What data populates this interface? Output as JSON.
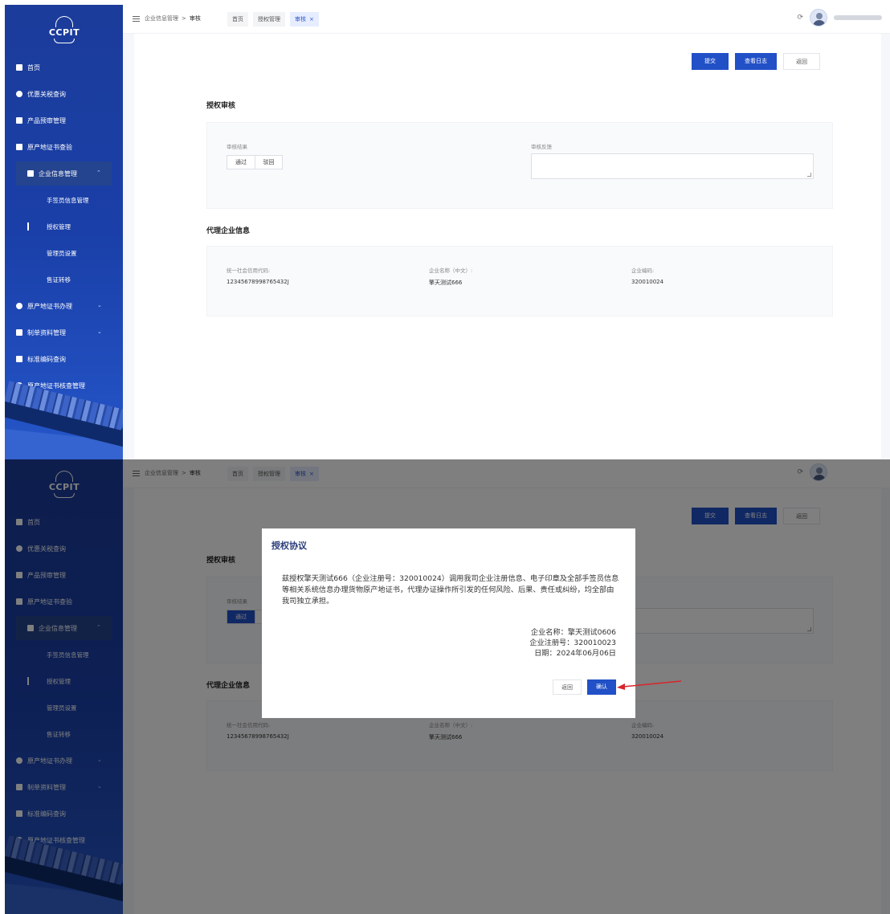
{
  "sidebar": {
    "logo_text": "CCPIT",
    "items": [
      {
        "label": "首页",
        "icon": "home-icon"
      },
      {
        "label": "优惠关税查询",
        "icon": "discount-icon"
      },
      {
        "label": "产品预审管理",
        "icon": "product-icon"
      },
      {
        "label": "原产地证书查验",
        "icon": "certificate-check-icon"
      },
      {
        "label": "企业信息管理",
        "icon": "enterprise-icon",
        "expanded": true
      },
      {
        "label": "手签员信息管理",
        "sub": true
      },
      {
        "label": "授权管理",
        "sub": true,
        "current": true
      },
      {
        "label": "管理员设置",
        "sub": true
      },
      {
        "label": "售证转移",
        "sub": true
      },
      {
        "label": "原产地证书办理",
        "icon": "certificate-apply-icon"
      },
      {
        "label": "制单资料管理",
        "icon": "document-icon"
      },
      {
        "label": "标准编码查询",
        "icon": "code-icon"
      },
      {
        "label": "原产地证书核查管理",
        "icon": "verify-icon"
      }
    ]
  },
  "topbar": {
    "breadcrumb_parent": "企业信息管理",
    "breadcrumb_sep": ">",
    "breadcrumb_current": "审核",
    "tags": [
      {
        "label": "首页",
        "active": false
      },
      {
        "label": "授权管理",
        "active": false
      },
      {
        "label": "审核",
        "active": true,
        "closable": true
      }
    ],
    "close_glyph": "×",
    "refresh_glyph": "⟳"
  },
  "actions": {
    "submit": "提交",
    "view_log": "查看日志",
    "back": "返回"
  },
  "review": {
    "section_title": "授权审核",
    "result_label": "审核结果",
    "result_options": [
      "通过",
      "驳回"
    ],
    "selected_first_view": "",
    "selected_second_view": "通过",
    "feedback_label": "审核反馈",
    "feedback_value": ""
  },
  "agent": {
    "section_title": "代理企业信息",
    "credit_code_label": "统一社会信用代码:",
    "credit_code_value": "12345678998765432J",
    "name_label": "企业名称（中文）:",
    "name_value": "擎天测试666",
    "code_label": "企业编码:",
    "code_value": "320010024"
  },
  "dialog": {
    "title": "授权协议",
    "body": "兹授权擎天测试666（企业注册号：320010024）调用我司企业注册信息、电子印章及全部手签员信息等相关系统信息办理货物原产地证书，代理办证操作所引发的任何风险、后果、责任或纠纷，均全部由我司独立承担。",
    "sign_company": "企业名称：擎天测试0606",
    "sign_reg": "企业注册号：320010023",
    "sign_date": "日期：2024年06月06日",
    "cancel": "返回",
    "confirm": "确认"
  },
  "colors": {
    "primary": "#2150c7",
    "sidebar": "#1b3c9a",
    "annotation_arrow": "#d9252a"
  }
}
